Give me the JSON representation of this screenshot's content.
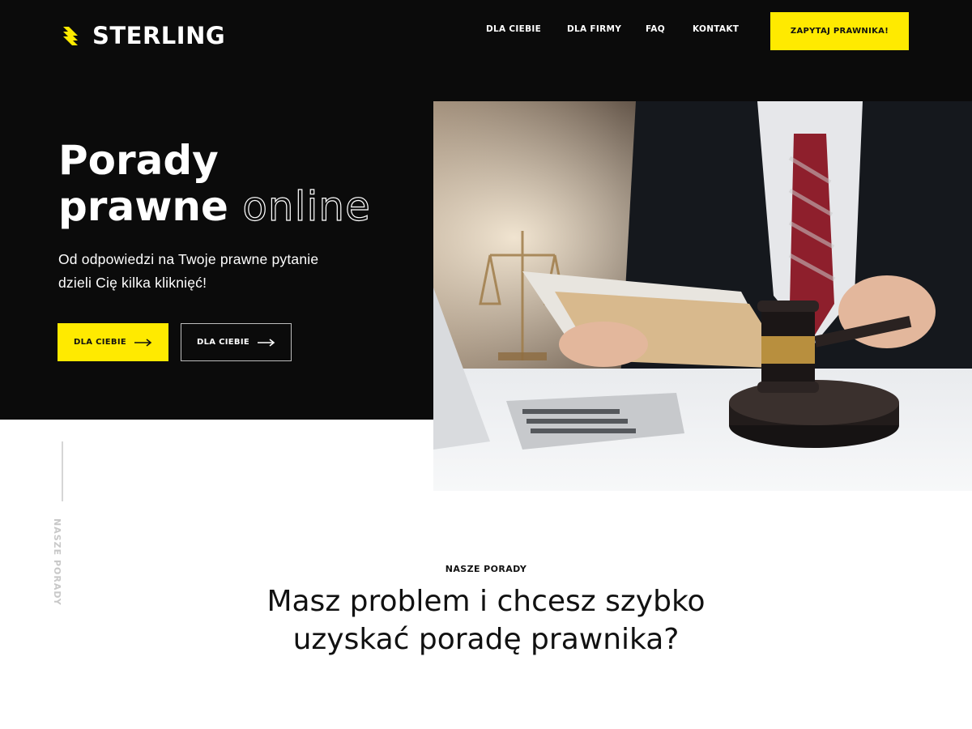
{
  "brand": {
    "name": "STERLING",
    "accent": "#ffea00",
    "dark": "#0b0b0b",
    "logo_icon": "stripes-logo-icon"
  },
  "nav": {
    "items": [
      {
        "label": "DLA CIEBIE"
      },
      {
        "label": "DLA FIRMY"
      },
      {
        "label": "FAQ"
      },
      {
        "label": "KONTAKT"
      }
    ],
    "cta_label": "ZAPYTAJ PRAWNIKA!"
  },
  "hero": {
    "title_line1": "Porady",
    "title_line2": "prawne",
    "title_outline": "online",
    "subtitle": "Od odpowiedzi na Twoje prawne pytanie dzieli Cię kilka kliknięć!",
    "buttons": [
      {
        "label": "DLA CIEBIE",
        "icon": "arrow-right-icon"
      },
      {
        "label": "DLA CIEBIE",
        "icon": "arrow-right-icon"
      }
    ]
  },
  "side_label": "NASZE PORADY",
  "section": {
    "eyebrow": "NASZE PORADY",
    "title_line1": "Masz problem i chcesz szybko",
    "title_line2": "uzyskać poradę prawnika?"
  }
}
